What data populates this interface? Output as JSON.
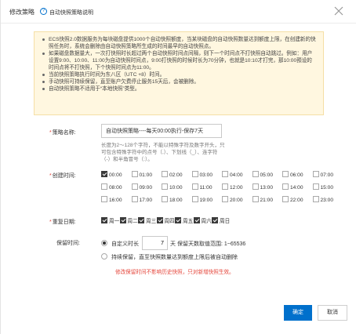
{
  "dialog": {
    "title": "修改策略",
    "help_link": "自动快照策略说明"
  },
  "notice": {
    "items": [
      "ECS快照2.0数据服务为每块磁盘提供1000个自动快照额度，当某块磁盘的自动快照数量达到额度上限，在创建新的快照任务时，系统会删除由自动快照策略所生成的时间最早的自动快照点。",
      "如果磁盘数据量大，一次打快照时长超过两个自动快照时间点间隔，则下一个时间点不打快照自动跳过。例如：用户设置9:00、10:00、11:00为自动快照时间点，9:00打快照的时候时长为70分钟，也就是10:10才打完，那10:00預设的时间点将不打快照，下个快照时间点为11:00。",
      "当前快照策略执行时间为东八区（UTC +8）时间。",
      "手动快照可持续保留，直至账户欠费停止服务15天后，会被删除。",
      "自动快照策略不适用于“本地快照”类型。"
    ]
  },
  "form": {
    "name_label": "策略名称:",
    "name_value": "自动快照策略----每天00:00执行-保存7天",
    "name_hint": "长度为2～128个字符，不能以特殊字符及数字开头，只可包含特殊字符中的点号（.）、下划线（_）、连字符（-）和半角冒号（:）。",
    "time_label": "创建时间:",
    "times": [
      {
        "label": "00:00",
        "checked": true
      },
      {
        "label": "01:00",
        "checked": false
      },
      {
        "label": "02:00",
        "checked": false
      },
      {
        "label": "03:00",
        "checked": false
      },
      {
        "label": "04:00",
        "checked": false
      },
      {
        "label": "05:00",
        "checked": false
      },
      {
        "label": "06:00",
        "checked": false
      },
      {
        "label": "07:00",
        "checked": false
      },
      {
        "label": "08:00",
        "checked": false
      },
      {
        "label": "09:00",
        "checked": false
      },
      {
        "label": "10:00",
        "checked": false
      },
      {
        "label": "11:00",
        "checked": false
      },
      {
        "label": "12:00",
        "checked": false
      },
      {
        "label": "13:00",
        "checked": false
      },
      {
        "label": "14:00",
        "checked": false
      },
      {
        "label": "15:00",
        "checked": false
      },
      {
        "label": "16:00",
        "checked": false
      },
      {
        "label": "17:00",
        "checked": false
      },
      {
        "label": "18:00",
        "checked": false
      },
      {
        "label": "19:00",
        "checked": false
      },
      {
        "label": "20:00",
        "checked": false
      },
      {
        "label": "21:00",
        "checked": false
      },
      {
        "label": "22:00",
        "checked": false
      },
      {
        "label": "23:00",
        "checked": false
      }
    ],
    "repeat_label": "重复日期:",
    "days": [
      {
        "label": "周一",
        "checked": true
      },
      {
        "label": "周二",
        "checked": true
      },
      {
        "label": "周三",
        "checked": true
      },
      {
        "label": "周四",
        "checked": true
      },
      {
        "label": "周五",
        "checked": true
      },
      {
        "label": "周六",
        "checked": true
      },
      {
        "label": "周日",
        "checked": true
      }
    ],
    "retention_label": "保留时间:",
    "custom_label": "自定义时长",
    "custom_value": "7",
    "custom_unit": "天 保留天数取值范围: 1~65536",
    "forever_label": "持续保留，直至快照数量达到额度上限后被自动删除",
    "warning": "修改保留时间不影响历史快照，只对新增快照生效。"
  },
  "footer": {
    "ok_label": "确定",
    "cancel_label": "取消"
  },
  "colors": {
    "primary": "#0070cc",
    "notice_bg": "#fff7e0",
    "required": "#e5463b"
  }
}
